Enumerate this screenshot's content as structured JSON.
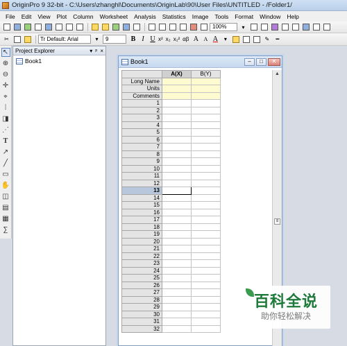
{
  "window": {
    "title": "OriginPro 9 32-bit - C:\\Users\\zhanghl\\Documents\\OriginLab\\90\\User Files\\UNTITLED - /Folder1/"
  },
  "menu": [
    "File",
    "Edit",
    "View",
    "Plot",
    "Column",
    "Worksheet",
    "Analysis",
    "Statistics",
    "Image",
    "Tools",
    "Format",
    "Window",
    "Help"
  ],
  "toolbar": {
    "zoom": "100%",
    "font": "Tr Default: Arial",
    "font_size": "9",
    "bold": "B",
    "italic": "I",
    "underline": "U",
    "superscript": "x²",
    "subscript": "x₂",
    "superscript_subscript": "x₁²",
    "greek": "αβ",
    "increase_font": "A",
    "decrease_font": "A",
    "text_color": "A"
  },
  "explorer": {
    "title": "Project Explorer",
    "pin": "▾",
    "pin2": "ᵖ",
    "close": "×",
    "items": [
      {
        "label": "Book1"
      }
    ]
  },
  "book": {
    "title": "Book1",
    "columns": [
      {
        "label": "A(X)",
        "selected": true
      },
      {
        "label": "B(Y)",
        "selected": false
      }
    ],
    "meta_rows": [
      "Long Name",
      "Units",
      "Comments"
    ],
    "rows": [
      "1",
      "2",
      "3",
      "4",
      "5",
      "6",
      "7",
      "8",
      "9",
      "10",
      "11",
      "12",
      "13",
      "14",
      "15",
      "16",
      "17",
      "18",
      "19",
      "20",
      "21",
      "22",
      "23",
      "24",
      "25",
      "26",
      "27",
      "28",
      "29",
      "30",
      "31",
      "32"
    ],
    "current_row": "13"
  },
  "watermark": {
    "main": "百科全说",
    "sub": "助你轻松解决"
  },
  "colors": {
    "meta_row_bg": "#fffbd0",
    "current_row_bg": "#b9c7dc",
    "watermark_green": "#1d7a3a"
  }
}
